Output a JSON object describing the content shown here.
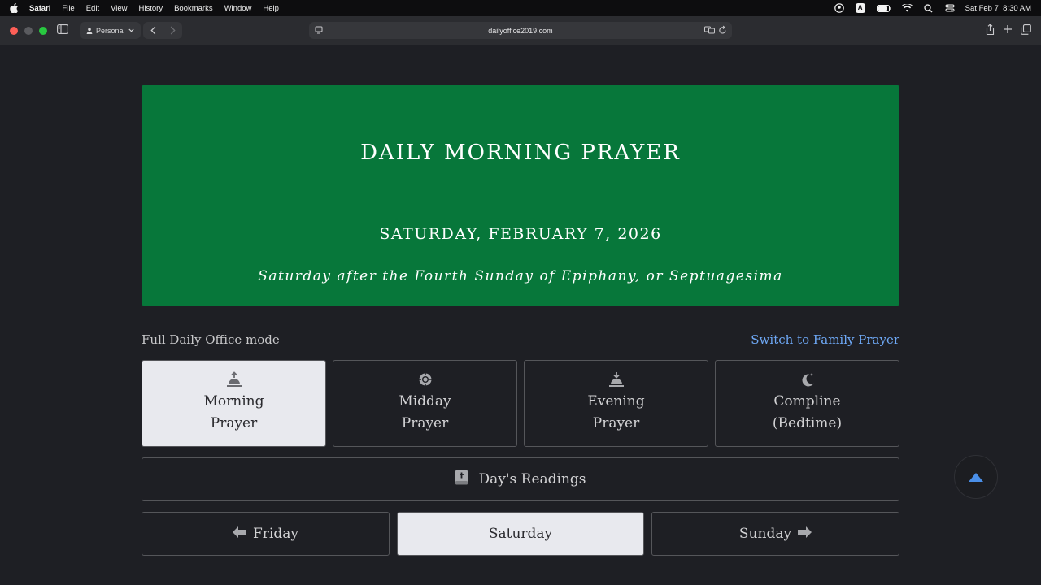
{
  "menubar": {
    "app": "Safari",
    "items": [
      "File",
      "Edit",
      "View",
      "History",
      "Bookmarks",
      "Window",
      "Help"
    ],
    "clock": "Sat Feb 7  8:30 AM",
    "input_indicator": "A"
  },
  "toolbar": {
    "profile": "Personal",
    "url": "dailyoffice2019.com"
  },
  "hero": {
    "title": "DAILY MORNING PRAYER",
    "date": "SATURDAY, FEBRUARY 7, 2026",
    "subtitle": "Saturday after the Fourth Sunday of Epiphany, or Septuagesima",
    "color": "#07773a"
  },
  "mode": {
    "label": "Full Daily Office mode",
    "switch_link": "Switch to Family Prayer"
  },
  "offices": [
    {
      "line1": "Morning",
      "line2": "Prayer",
      "icon": "sunrise-icon",
      "active": true
    },
    {
      "line1": "Midday",
      "line2": "Prayer",
      "icon": "sun-icon",
      "active": false
    },
    {
      "line1": "Evening",
      "line2": "Prayer",
      "icon": "sunset-icon",
      "active": false
    },
    {
      "line1": "Compline",
      "line2": "(Bedtime)",
      "icon": "moon-icon",
      "active": false
    }
  ],
  "readings": {
    "label": "Day's Readings",
    "icon": "bible-icon"
  },
  "days": {
    "prev": "Friday",
    "current": "Saturday",
    "next": "Sunday"
  },
  "colors": {
    "link": "#6ea8f5",
    "accent_arrow": "#4a8fe8"
  }
}
